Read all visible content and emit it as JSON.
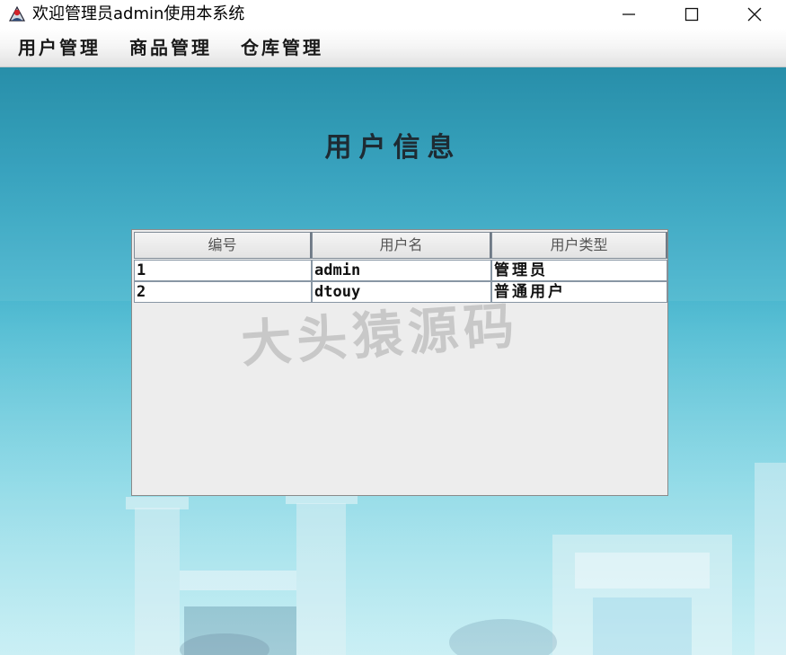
{
  "window": {
    "title": "欢迎管理员admin使用本系统",
    "controls": [
      "minimize-icon",
      "maximize-icon",
      "close-icon"
    ]
  },
  "menu": {
    "items": [
      {
        "label": "用户管理"
      },
      {
        "label": "商品管理"
      },
      {
        "label": "仓库管理"
      }
    ]
  },
  "main": {
    "title": "用户信息",
    "table": {
      "columns": [
        "编号",
        "用户名",
        "用户类型"
      ],
      "rows": [
        [
          "1",
          "admin",
          "管理员"
        ],
        [
          "2",
          "dtouy",
          "普通用户"
        ]
      ]
    }
  },
  "watermark": "大头猿源码",
  "colors": {
    "background_top": "#1a88a4",
    "background_bottom": "#aee7ef",
    "title_text": "#1e2b33",
    "table_bg": "#ededed"
  }
}
